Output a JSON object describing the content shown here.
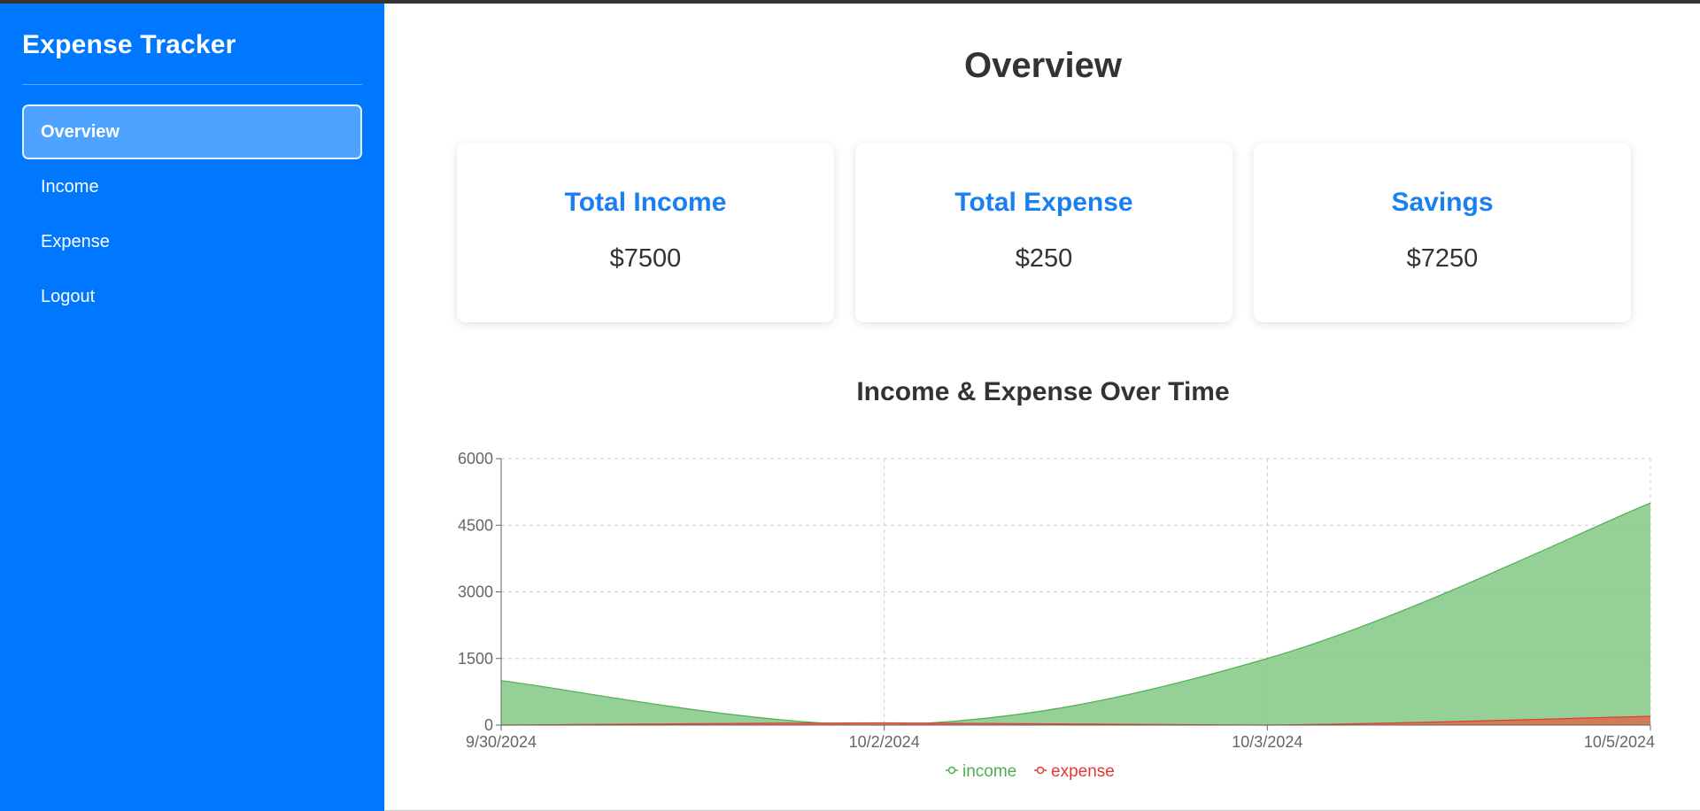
{
  "sidebar": {
    "brand": "Expense Tracker",
    "items": [
      {
        "label": "Overview",
        "active": true
      },
      {
        "label": "Income",
        "active": false
      },
      {
        "label": "Expense",
        "active": false
      },
      {
        "label": "Logout",
        "active": false
      }
    ]
  },
  "main": {
    "title": "Overview",
    "cards": [
      {
        "title": "Total Income",
        "value": "$7500"
      },
      {
        "title": "Total Expense",
        "value": "$250"
      },
      {
        "title": "Savings",
        "value": "$7250"
      }
    ],
    "chart_title": "Income & Expense Over Time"
  },
  "colors": {
    "sidebar": "#0077ff",
    "accent": "#1a7ff0",
    "income_fill": "#82c884",
    "income_stroke": "#4caf50",
    "expense_fill": "#d9704f",
    "expense_stroke": "#e53935"
  },
  "chart_data": {
    "type": "area",
    "title": "Income & Expense Over Time",
    "x": [
      "9/30/2024",
      "10/2/2024",
      "10/3/2024",
      "10/5/2024"
    ],
    "ylim": [
      0,
      6000
    ],
    "yticks": [
      0,
      1500,
      3000,
      4500,
      6000
    ],
    "grid": true,
    "legend_position": "bottom",
    "series": [
      {
        "name": "income",
        "values": [
          1000,
          0,
          1500,
          5000
        ]
      },
      {
        "name": "expense",
        "values": [
          0,
          50,
          0,
          200
        ]
      }
    ]
  }
}
